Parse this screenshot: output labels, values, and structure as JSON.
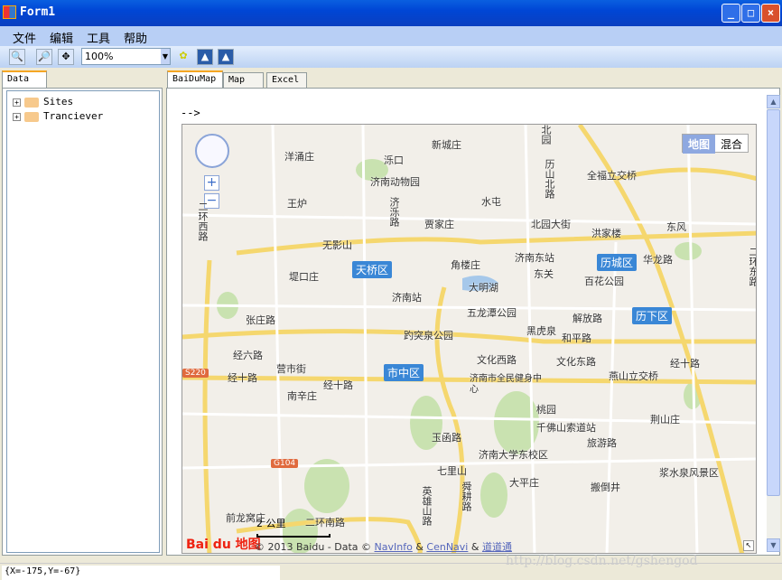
{
  "window": {
    "title": "Form1",
    "minimize": "_",
    "maximize": "□",
    "close": "×"
  },
  "menu": [
    "文件",
    "编辑",
    "工具",
    "帮助"
  ],
  "toolbar": {
    "zoom": "100%",
    "icons": [
      "zoom-in-icon",
      "zoom-out-icon",
      "pan-icon",
      "layers-icon",
      "image-icon",
      "image-icon"
    ]
  },
  "left_tab": "Data",
  "tree": [
    {
      "label": "Sites",
      "expander": "+"
    },
    {
      "label": "Tranciever",
      "expander": "+"
    }
  ],
  "tabs": [
    "BaiDuMap",
    "Map",
    "Excel"
  ],
  "arrow_text": "-->",
  "map": {
    "type_buttons": [
      "地图",
      "混合"
    ],
    "zoom_in": "+",
    "zoom_out": "−",
    "districts": [
      "天桥区",
      "历城区",
      "历下区",
      "市中区"
    ],
    "highways": [
      "S220",
      "G104"
    ],
    "labels": [
      "洋涌庄",
      "泺口",
      "新城庄",
      "北园",
      "历山北路",
      "全福立交桥",
      "济南动物园",
      "王炉",
      "水屯",
      "济泺路",
      "贾家庄",
      "北园大街",
      "洪家楼",
      "东风",
      "二环西路",
      "无影山",
      "济南东站",
      "角楼庄",
      "堤口庄",
      "东关",
      "华龙路",
      "大明湖",
      "百花公园",
      "济南站",
      "五龙潭公园",
      "张庄路",
      "黑虎泉",
      "解放路",
      "趵突泉公园",
      "和平路",
      "经六路",
      "文化西路",
      "文化东路",
      "营市街",
      "经十路",
      "经十路",
      "济南市全民健身中心",
      "燕山立交桥",
      "经十路",
      "南辛庄",
      "桃园",
      "千佛山索道站",
      "荆山庄",
      "玉函路",
      "济南大学东校区",
      "旅游路",
      "七里山",
      "大平庄",
      "浆水泉风景区",
      "搬倒井",
      "英雄山路",
      "舜耕路",
      "前龙窝庄",
      "二环南路",
      "二环东路"
    ],
    "scale": "2 公里",
    "logo": "Bai du 地图",
    "copyright": "© 2013 Baidu - Data ©",
    "links": [
      "NavInfo",
      "CenNavi",
      "道道通"
    ],
    "amp": "&"
  },
  "status": "{X=-175,Y=-67}",
  "watermark": "http://blog.csdn.net/gshengod"
}
